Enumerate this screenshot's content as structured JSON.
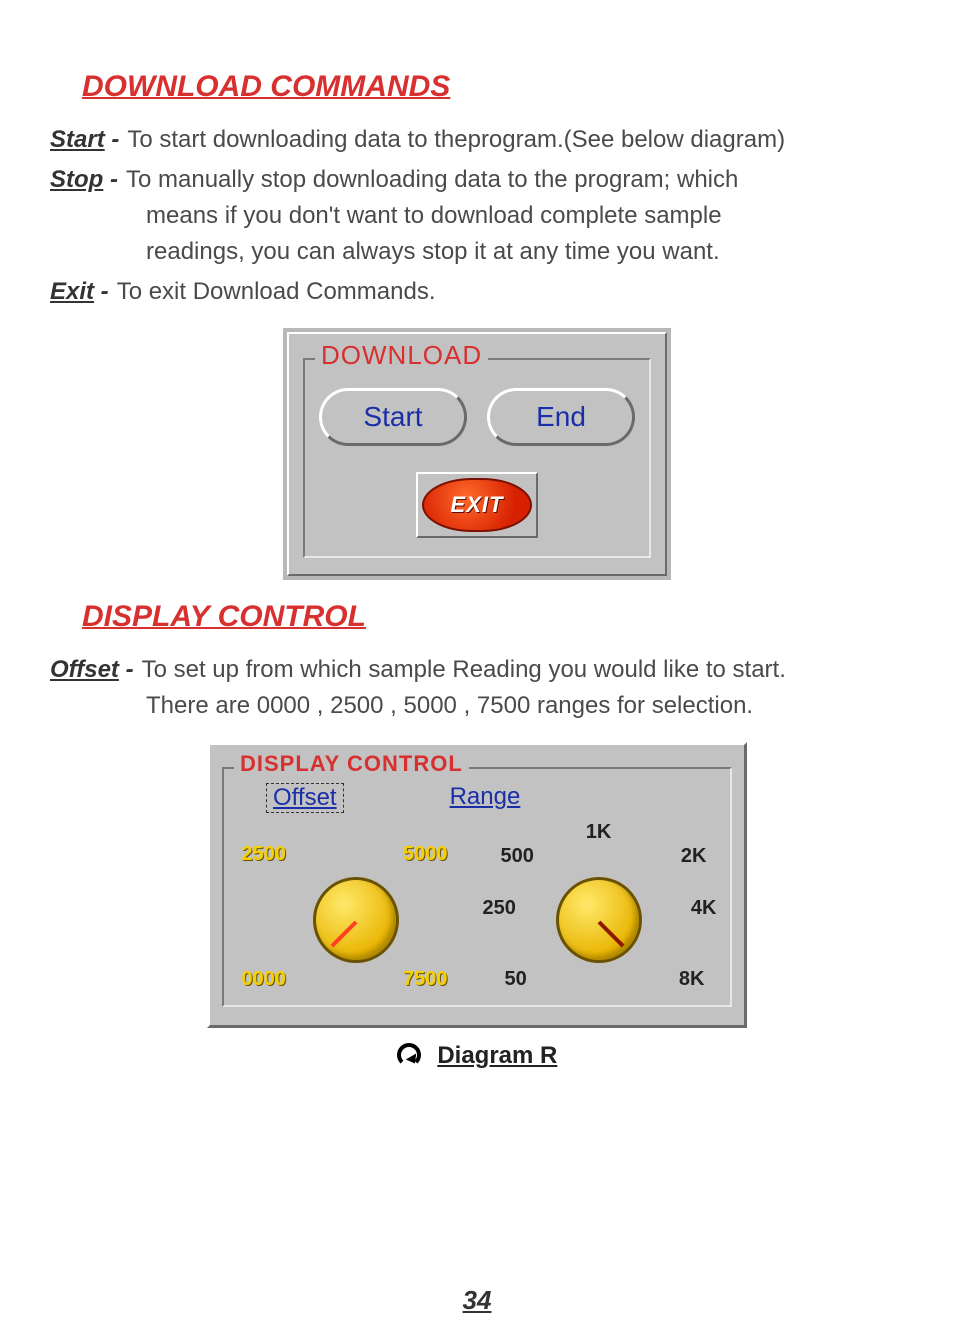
{
  "sections": {
    "download": {
      "title": "DOWNLOAD COMMANDS",
      "defs": {
        "start": {
          "term": "Start",
          "text": "To start downloading data to theprogram.(See below diagram)"
        },
        "stop": {
          "term": "Stop",
          "line1": "To manually stop downloading data to the program; which",
          "line2": "means if you don't want to download complete sample",
          "line3": "readings, you can always stop it at any time you want."
        },
        "exit": {
          "term": "Exit",
          "text": "To exit  Download Commands."
        }
      },
      "panel": {
        "legend": "DOWNLOAD",
        "btn_start": "Start",
        "btn_end": "End",
        "btn_exit": "EXIT"
      }
    },
    "display": {
      "title": "DISPLAY CONTROL",
      "defs": {
        "offset": {
          "term": "Offset",
          "line1": "To set up from which sample Reading you would like to start.",
          "line2": "There are 0000 , 2500 , 5000 , 7500 ranges for selection."
        }
      },
      "panel": {
        "legend": "DISPLAY CONTROL",
        "tab_offset": "Offset",
        "tab_range": "Range",
        "offset_labels": {
          "tl": "2500",
          "tr": "5000",
          "bl": "0000",
          "br": "7500"
        },
        "range_labels": {
          "t": "1K",
          "tl": "500",
          "tr": "2K",
          "ml": "250",
          "mr": "4K",
          "bl": "50",
          "br": "8K"
        }
      },
      "diagram_label": "Diagram R"
    }
  },
  "page_number": "34"
}
